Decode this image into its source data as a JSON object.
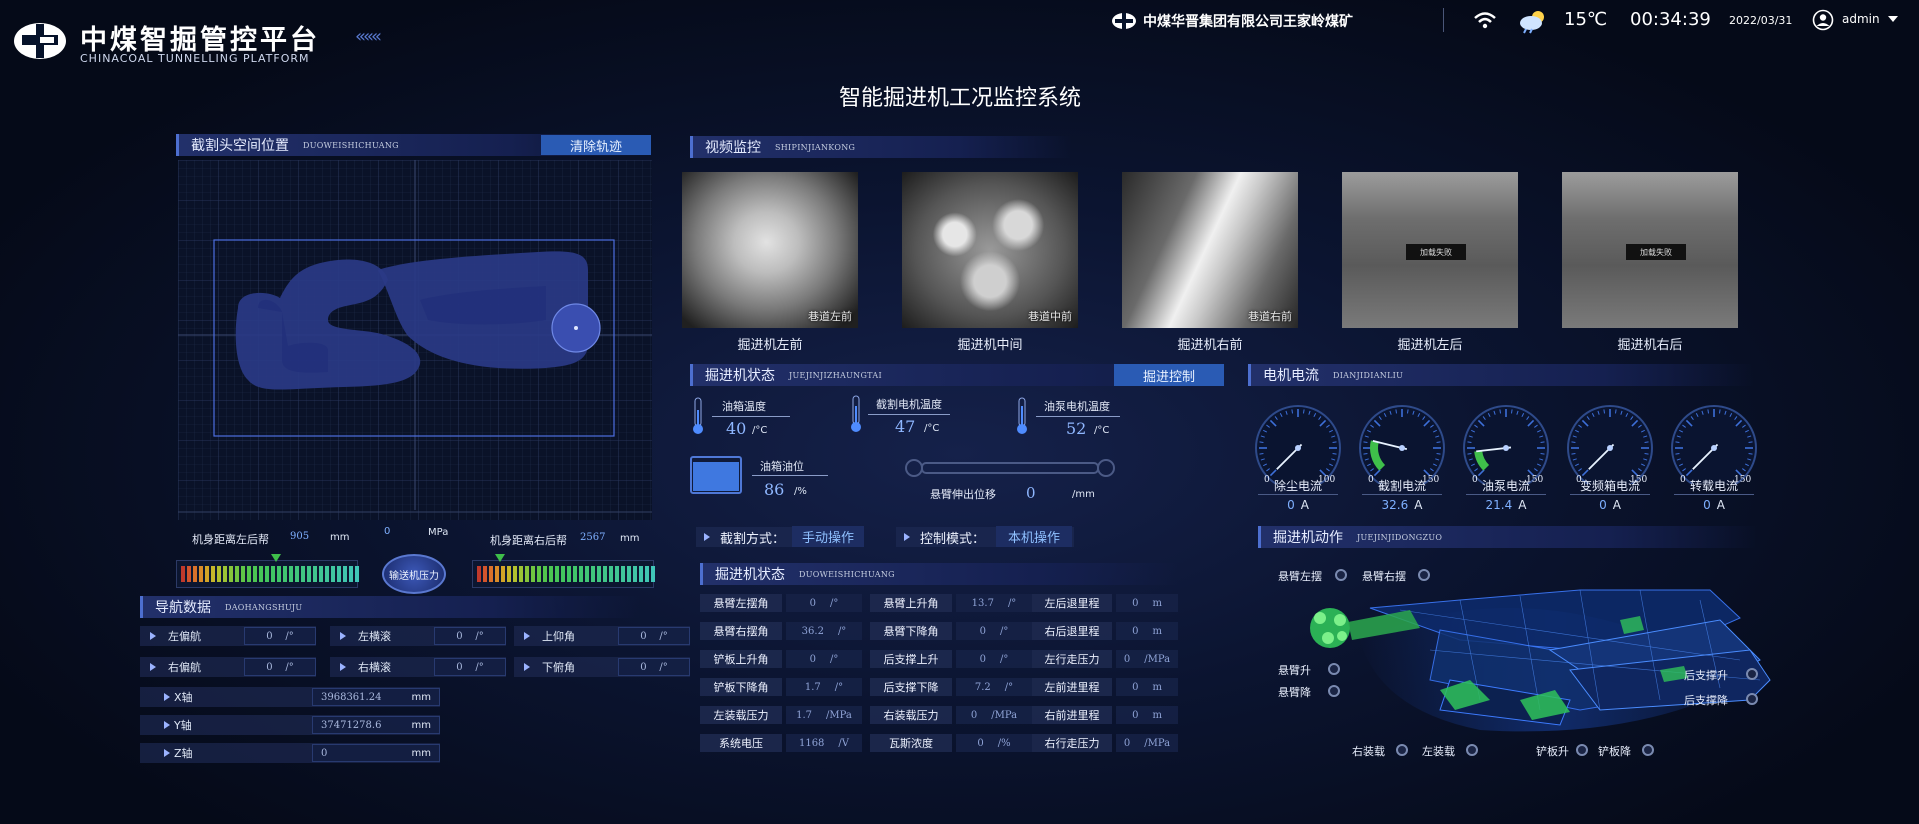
{
  "header": {
    "logo_cn": "中煤智掘管控平台",
    "logo_en": "CHINACOAL TUNNELLING PLATFORM",
    "company": "中煤华晋集团有限公司王家岭煤矿",
    "temperature": "15℃",
    "time": "00:34:39",
    "date": "2022/03/31",
    "user": "admin",
    "page_title": "智能掘进机工况监控系统"
  },
  "cutting_position": {
    "title": "截割头空间位置",
    "subtitle": "DUOWEISHICHUANG",
    "clear_button": "清除轨迹",
    "left_label": "机身距离左后帮",
    "left_value": "905",
    "left_unit": "mm",
    "pressure_value": "0",
    "pressure_unit": "MPa",
    "right_label": "机身距离右后帮",
    "right_value": "2567",
    "right_unit": "mm",
    "center_label": "输送机压力",
    "left_bar_fill": 0.52,
    "right_bar_fill": 0.14
  },
  "navigation": {
    "title": "导航数据",
    "subtitle": "DAOHANGSHUJU",
    "row1": [
      {
        "label": "左偏航",
        "value": "0",
        "unit": "/°"
      },
      {
        "label": "左横滚",
        "value": "0",
        "unit": "/°"
      },
      {
        "label": "上仰角",
        "value": "0",
        "unit": "/°"
      }
    ],
    "row2": [
      {
        "label": "右偏航",
        "value": "0",
        "unit": "/°"
      },
      {
        "label": "右横滚",
        "value": "0",
        "unit": "/°"
      },
      {
        "label": "下俯角",
        "value": "0",
        "unit": "/°"
      }
    ],
    "axes": [
      {
        "label": "X轴",
        "value": "3968361.24",
        "unit": "mm"
      },
      {
        "label": "Y轴",
        "value": "37471278.6",
        "unit": "mm"
      },
      {
        "label": "Z轴",
        "value": "0",
        "unit": "mm"
      }
    ]
  },
  "video": {
    "title": "视频监控",
    "subtitle": "SHIPINJIANKONG",
    "cameras": [
      {
        "caption": "掘进机左前",
        "overlay": "巷道左前",
        "fail": ""
      },
      {
        "caption": "掘进机中间",
        "overlay": "巷道中前",
        "fail": ""
      },
      {
        "caption": "掘进机右前",
        "overlay": "巷道右前",
        "fail": ""
      },
      {
        "caption": "掘进机左后",
        "overlay": "",
        "fail": "加载失败"
      },
      {
        "caption": "掘进机右后",
        "overlay": "",
        "fail": "加载失败"
      }
    ]
  },
  "status": {
    "title": "掘进机状态",
    "subtitle": "JUEJINJIZHAUNGTAI",
    "control_button": "掘进控制",
    "temps": [
      {
        "label": "油箱温度",
        "value": "40",
        "unit": "/°C"
      },
      {
        "label": "截割电机温度",
        "value": "47",
        "unit": "/°C"
      },
      {
        "label": "油泵电机温度",
        "value": "52",
        "unit": "/°C"
      }
    ],
    "oil_label": "油箱油位",
    "oil_value": "86",
    "oil_unit": "/%",
    "oil_level": 0.86,
    "boom_label": "悬臂伸出位移",
    "boom_value": "0",
    "boom_unit": "/mm",
    "cut_mode_label": "截割方式：",
    "cut_mode_value": "手动操作",
    "control_mode_label": "控制模式：",
    "control_mode_value": "本机操作"
  },
  "table": {
    "title": "掘进机状态",
    "subtitle": "DUOWEISHICHUANG",
    "rows": [
      [
        {
          "label": "悬臂左摆角",
          "value": "0",
          "unit": "/°"
        },
        {
          "label": "悬臂上升角",
          "value": "13.7",
          "unit": "/°"
        },
        {
          "label": "左后退里程",
          "value": "0",
          "unit": "m"
        }
      ],
      [
        {
          "label": "悬臂右摆角",
          "value": "36.2",
          "unit": "/°"
        },
        {
          "label": "悬臂下降角",
          "value": "0",
          "unit": "/°"
        },
        {
          "label": "右后退里程",
          "value": "0",
          "unit": "m"
        }
      ],
      [
        {
          "label": "铲板上升角",
          "value": "0",
          "unit": "/°"
        },
        {
          "label": "后支撑上升",
          "value": "0",
          "unit": "/°"
        },
        {
          "label": "左行走压力",
          "value": "0",
          "unit": "/MPa"
        }
      ],
      [
        {
          "label": "铲板下降角",
          "value": "1.7",
          "unit": "/°"
        },
        {
          "label": "后支撑下降",
          "value": "7.2",
          "unit": "/°"
        },
        {
          "label": "左前进里程",
          "value": "0",
          "unit": "m"
        }
      ],
      [
        {
          "label": "左装载压力",
          "value": "1.7",
          "unit": "/MPa"
        },
        {
          "label": "右装载压力",
          "value": "0",
          "unit": "/MPa"
        },
        {
          "label": "右前进里程",
          "value": "0",
          "unit": "m"
        }
      ],
      [
        {
          "label": "系统电压",
          "value": "1168",
          "unit": "/V"
        },
        {
          "label": "瓦斯浓度",
          "value": "0",
          "unit": "/%"
        },
        {
          "label": "右行走压力",
          "value": "0",
          "unit": "/MPa"
        }
      ]
    ]
  },
  "motor_current": {
    "title": "电机电流",
    "subtitle": "DIANJIDIANLIU",
    "gauges": [
      {
        "title": "除尘电流",
        "value": "0",
        "unit": "A",
        "min": "0",
        "max": "100",
        "current": 0,
        "range_max": 100
      },
      {
        "title": "截割电流",
        "value": "32.6",
        "unit": "A",
        "min": "0",
        "max": "150",
        "current": 32.6,
        "range_max": 150
      },
      {
        "title": "油泵电流",
        "value": "21.4",
        "unit": "A",
        "min": "0",
        "max": "150",
        "current": 21.4,
        "range_max": 150
      },
      {
        "title": "变频箱电流",
        "value": "0",
        "unit": "A",
        "min": "0",
        "max": "150",
        "current": 0,
        "range_max": 150
      },
      {
        "title": "转载电流",
        "value": "0",
        "unit": "A",
        "min": "0",
        "max": "150",
        "current": 0,
        "range_max": 150
      }
    ]
  },
  "actions": {
    "title": "掘进机动作",
    "subtitle": "JUEJINJIDONGZUO",
    "boom_left": "悬臂左摆",
    "boom_right": "悬臂右摆",
    "boom_up": "悬臂升",
    "boom_down": "悬臂降",
    "rear_up": "后支撑升",
    "rear_down": "后支撑降",
    "load_right": "右装载",
    "load_left": "左装载",
    "shovel_up": "铲板升",
    "shovel_down": "铲板降"
  },
  "colors": {
    "accent": "#2a5bb4",
    "value_text": "#7fb0ff",
    "gauge_green": "#3fbf4a"
  }
}
